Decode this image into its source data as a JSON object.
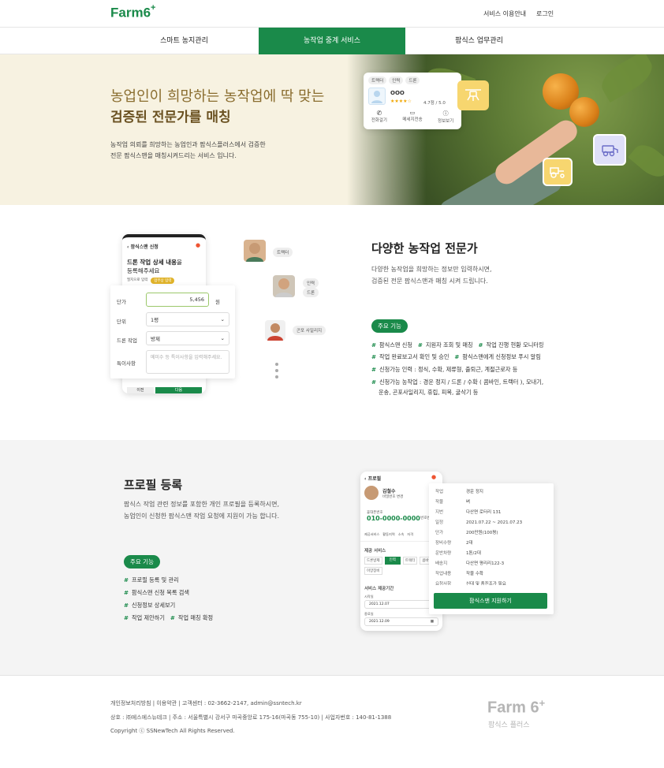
{
  "header": {
    "logo_text": "Farm",
    "logo_num": "6",
    "logo_plus": "+",
    "links": [
      "서비스 이용안내",
      "로그인"
    ]
  },
  "nav": {
    "items": [
      "스마트 농지관리",
      "농작업 중계 서비스",
      "팜식스 업무관리"
    ],
    "active_index": 1
  },
  "hero": {
    "title_line1": "농업인이 희망하는 농작업에 딱 맞는",
    "title_line2": "검증된 전문가를 매칭",
    "desc_line1": "농작업 의뢰를 희망하는 농업인과 팜식스플러스에서 검증한",
    "desc_line2": "전문 팜식스맨을 매칭시켜드리는 서비스 입니다.",
    "card": {
      "tags": [
        "트랙터",
        "인력",
        "드론"
      ],
      "name": "OOO",
      "stars": "★★★★☆",
      "rating": "4.7점 / 5.0",
      "actions": [
        "전화걸기",
        "메세지전송",
        "정보보기"
      ]
    }
  },
  "experts": {
    "title": "다양한 농작업 전문가",
    "desc_line1": "다양한 농작업을 희망하는 정보만 입력하시면,",
    "desc_line2": "검증된 전문 팜식스맨과 매칭 시켜 드립니다.",
    "pill": "주요 기능",
    "features": [
      [
        "팜식스맨 신청",
        "지원자 조회 및 매칭",
        "작업 진행 현황 모니터링"
      ],
      [
        "작업 완료보고서 확인 및 승인",
        "팜식스맨에게 신청정보 푸시 알림"
      ],
      [
        "신청가능 인력 : 정식, 수확, 제류형, 출퇴근, 계절근로자 등"
      ]
    ],
    "feature_last_line1": "신청가능 농작업 : 경운 정지 / 드론 / 수확 ( 콤바인, 트랙터 ), 모내기,",
    "feature_last_line2": "운송, 곤포사일리지, 휴립, 피복, 굴삭기 등",
    "avatar_tags": [
      "트랙터",
      "인력",
      "드론",
      "곤포 사일리지"
    ],
    "phone": {
      "header": "팜식스맨 신청",
      "heading_bold": "드론 작업 상세 내용",
      "heading_rest": "을",
      "heading_line2": "등록해주세요",
      "chips": [
        "필지으로 입력",
        "업무상 입력"
      ]
    },
    "form": {
      "rows": [
        {
          "label": "단가",
          "value": "5,456",
          "suffix": "원"
        },
        {
          "label": "단위",
          "value": "1평",
          "suffix": ""
        },
        {
          "label": "드론 작업",
          "value": "방제",
          "suffix": ""
        },
        {
          "label": "특이사항",
          "value": "",
          "suffix": ""
        }
      ],
      "note_placeholder": "메미수 등 특이사항을 입력해주세요.",
      "buttons": [
        "이전",
        "다음"
      ]
    }
  },
  "profile": {
    "title": "프로필 등록",
    "desc_line1": "팜식스 작업 관련 정보를 포함한 개인 프로필을 등록하시면,",
    "desc_line2": "농업인이 신청한 팜식스맨 작업 요청에 지원이 가능 합니다.",
    "pill": "주요 기능",
    "features": [
      [
        "프로필 등록 및 관리"
      ],
      [
        "팜식스맨 신청 목록 검색"
      ],
      [
        "신청정보 상세보기"
      ],
      [
        "작업 제안하기",
        "작업 매칭 확정"
      ]
    ],
    "phone": {
      "header": "프로필",
      "name": "김철수",
      "sub": "비밀번호 변경",
      "phone_label": "휴대폰번호",
      "phone": "010-0000-0000",
      "phone_btn": "번호변경",
      "tabs": [
        "제공서비스",
        "활동지역",
        "소속",
        "자격"
      ],
      "service_label": "제공 서비스",
      "services": [
        "드론방제",
        "인력",
        "트랙터",
        "콤바인",
        "이앙장비"
      ],
      "period_label": "서비스 제공기간",
      "start_label": "시작일",
      "start": "2021.12.07",
      "end_label": "종료일",
      "end": "2021.12.09"
    },
    "detail": {
      "rows": [
        [
          "작업",
          "경운 정지"
        ],
        [
          "작물",
          "벼"
        ],
        [
          "지번",
          "다산면 로터리 131"
        ],
        [
          "일정",
          "2021.07.22 ~ 2021.07.23"
        ],
        [
          "단가",
          "200만원(100평)"
        ],
        [
          "장비수량",
          "2대"
        ],
        [
          "운반차량",
          "1톤/2대"
        ],
        [
          "배송지",
          "다산면 평리리122-3"
        ],
        [
          "작업내용",
          "작물 수확"
        ],
        [
          "요청사항",
          "신대 및 충진조가 필요"
        ]
      ],
      "button": "팜식스맨 지원하기"
    }
  },
  "footer": {
    "line1": "개인정보처리방침  |  이용약관  |  고객센터 : 02-3662-2147, admin@ssntech.kr",
    "line2": "상호 : ㈜에스에스뉴테크  |  주소 : 서울특별시 강서구 마곡중앙로 175-16(마곡동 755-10)  |  사업자번호 : 140-81-1388",
    "line3": "Copyright ⓒ SSNewTech All Rights Reserved.",
    "logo_text": "Farm",
    "logo_num": "6",
    "logo_plus": "+",
    "logo_sub": "팜식스 플러스"
  },
  "colors": {
    "brand_green": "#1a8a4a",
    "hero_bg": "#f7f2e1",
    "hero_title": "#8a6d2f",
    "section_gray": "#f4f4f4"
  }
}
